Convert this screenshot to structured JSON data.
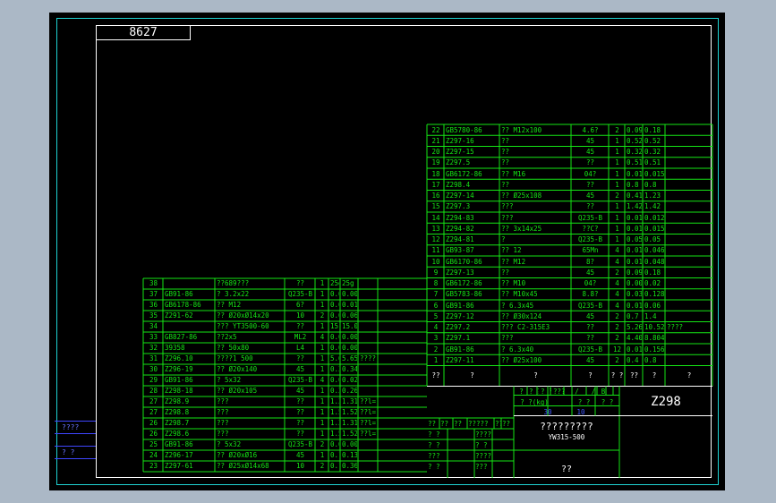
{
  "drawing_number": "8627",
  "margin_labels": [
    "????",
    "?  ?"
  ],
  "parts_right": [
    [
      "22",
      "GB5780-86",
      "?? M12x100",
      "4.6?",
      "2",
      "0.09",
      "0.18"
    ],
    [
      "21",
      "Z297-16",
      "??",
      "45",
      "1",
      "0.52",
      "0.52"
    ],
    [
      "20",
      "Z297-15",
      "??",
      "45",
      "1",
      "0.32",
      "0.32"
    ],
    [
      "19",
      "Z297.5",
      "??",
      "??",
      "1",
      "0.51",
      "0.51"
    ],
    [
      "18",
      "GB6172-86",
      "?? M16",
      "04?",
      "1",
      "0.015",
      "0.015"
    ],
    [
      "17",
      "Z298.4",
      "??",
      "??",
      "1",
      "0.8",
      "0.8"
    ],
    [
      "16",
      "Z297-14",
      "?? Ø25x108",
      "45",
      "2",
      "0.41",
      "1.23"
    ],
    [
      "15",
      "Z297.3",
      "???",
      "??",
      "1",
      "1.42",
      "1.42"
    ],
    [
      "14",
      "Z294-83",
      "???",
      "Q235-B",
      "1",
      "0.012",
      "0.012"
    ],
    [
      "13",
      "Z294-82",
      "?? 3x14x25",
      "??C?",
      "1",
      "0.015",
      "0.015"
    ],
    [
      "12",
      "Z294-81",
      "?",
      "Q235-B",
      "1",
      "0.05",
      "0.05"
    ],
    [
      "11",
      "GB93-87",
      "?? 12",
      "65Mn",
      "4",
      "0.0115",
      "0.046"
    ],
    [
      "10",
      "GB6170-86",
      "?? M12",
      "8?",
      "4",
      "0.012",
      "0.048"
    ],
    [
      "9",
      "Z297-13",
      "??",
      "45",
      "2",
      "0.09",
      "0.18"
    ],
    [
      "8",
      "GB6172-86",
      "?? M10",
      "04?",
      "4",
      "0.005",
      "0.02"
    ],
    [
      "7",
      "GB5783-86",
      "?? M10x45",
      "8.8?",
      "4",
      "0.032",
      "0.128"
    ],
    [
      "6",
      "GB91-86",
      "? 6.3x45",
      "Q235-B",
      "4",
      "0.015",
      "0.06"
    ],
    [
      "5",
      "Z297-12",
      "?? Ø30x124",
      "45",
      "2",
      "0.7",
      "1.4"
    ],
    [
      "4",
      "Z297.2",
      "??? C2-315E3",
      "??",
      "2",
      "5.26",
      "10.52",
      "????"
    ],
    [
      "3",
      "Z297.1",
      "???",
      "??",
      "2",
      "4.402",
      "8.804"
    ],
    [
      "2",
      "GB91-86",
      "? 6.3x40",
      "Q235-B",
      "12",
      "0.013",
      "0.156"
    ],
    [
      "1",
      "Z297-11",
      "?? Ø25x100",
      "45",
      "2",
      "0.4",
      "0.8"
    ]
  ],
  "parts_left": [
    [
      "38",
      "",
      "??689???",
      "??",
      "1",
      "25g",
      "25g",
      ""
    ],
    [
      "37",
      "GB91-86",
      "? 3.2x22",
      "Q235-B",
      "1",
      "0.002",
      "0.002",
      ""
    ],
    [
      "36",
      "GB6178-86",
      "?? M12",
      "6?",
      "1",
      "0.015",
      "0.015",
      ""
    ],
    [
      "35",
      "Z291-62",
      "?? Ø20xØ14x20",
      "10",
      "2",
      "0.03",
      "0.06",
      ""
    ],
    [
      "34",
      "",
      "??? YT3500-60",
      "??",
      "1",
      "15.0",
      "15.0",
      ""
    ],
    [
      "33",
      "GB827-86",
      "??2x5",
      "ML2",
      "4",
      "0.0007",
      "0.0028",
      ""
    ],
    [
      "32",
      "39358",
      "?? 50x80",
      "L4",
      "1",
      "0.008",
      "0.008",
      ""
    ],
    [
      "31",
      "Z296.10",
      "????1 500",
      "??",
      "1",
      "5.65",
      "5.65",
      "????"
    ],
    [
      "30",
      "Z296-19",
      "?? Ø20x140",
      "45",
      "1",
      "0.34",
      "0.34",
      ""
    ],
    [
      "29",
      "GB91-86",
      "? 5x32",
      "Q235-B",
      "4",
      "0.0068",
      "0.0272",
      ""
    ],
    [
      "28",
      "Z298-18",
      "?? Ø20x105",
      "45",
      "1",
      "0.26",
      "0.26",
      ""
    ],
    [
      "27",
      "Z298.9",
      "???",
      "??",
      "1",
      "1.31",
      "1.31",
      "??l=12.5"
    ],
    [
      "27",
      "Z298.8",
      "???",
      "??",
      "1",
      "1.52",
      "1.52",
      "??l=10"
    ],
    [
      "26",
      "Z298.7",
      "???",
      "??",
      "1",
      "1.31",
      "1.31",
      "??l=12.5"
    ],
    [
      "26",
      "Z298.6",
      "???",
      "??",
      "1",
      "1.52",
      "1.52",
      "??l=10"
    ],
    [
      "25",
      "GB91-86",
      "? 5x32",
      "Q235-B",
      "2",
      "0.0068",
      "0.0068",
      ""
    ],
    [
      "24",
      "Z296-17",
      "?? Ø20xØ16",
      "45",
      "1",
      "0.13",
      "0.13",
      ""
    ],
    [
      "23",
      "Z297-61",
      "?? Ø25xØ14x68",
      "10",
      "2",
      "0.18",
      "0.36",
      ""
    ]
  ],
  "header_right": [
    "??",
    "?",
    "?",
    "?",
    "? ?",
    "??",
    "?",
    "?"
  ],
  "header_unit": [
    "? ?",
    "??",
    "? ?",
    "??",
    "(kg)"
  ],
  "title_block": {
    "cells_row1": [
      "?",
      "? ?",
      "? ?",
      "????",
      "/",
      "/",
      "B"
    ],
    "cells_row2": [
      "? ?(kg)",
      "? ?",
      "? ?"
    ],
    "blue_row": [
      "30",
      "10"
    ],
    "drawing_code": "Z298",
    "name1": "?????????",
    "name2": "YW315-500",
    "name3": "??",
    "sign_rows": [
      [
        "??",
        "??",
        "??",
        "?????",
        "??",
        "??"
      ],
      [
        "? ?",
        "",
        "?????",
        ""
      ],
      [
        "? ?",
        "",
        "? ? ?",
        ""
      ],
      [
        "???",
        "",
        "????",
        ""
      ],
      [
        "? ?",
        "",
        "???",
        ""
      ]
    ]
  },
  "colors": {
    "frame": "#1fd3d3",
    "text": "#15e515",
    "border": "#ffffff",
    "blue": "#3f46ff",
    "background": "#000000"
  }
}
